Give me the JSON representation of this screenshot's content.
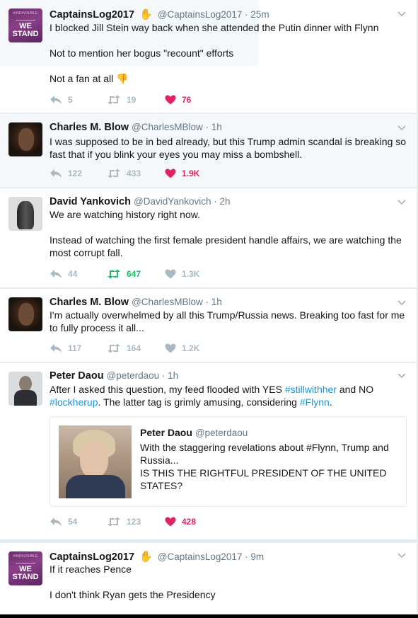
{
  "tweets": [
    {
      "author": "CaptainsLog2017",
      "handle": "@CaptainsLog2017",
      "time": "25m",
      "text": "I blocked Jill Stein way back when she attended the Putin dinner with Flynn\n\nNot to mention her bogus \"recount\" efforts\n\nNot a fan at all 👎",
      "avatar": "we-stand-avatar",
      "replies": "5",
      "retweets": "19",
      "likes": "76",
      "liked": true
    },
    {
      "author": "Charles M. Blow",
      "handle": "@CharlesMBlow",
      "time": "1h",
      "text": "I was supposed to be in bed already, but this Trump admin scandal is breaking so fast that if you blink your eyes you may miss a bombshell.",
      "replies": "122",
      "retweets": "433",
      "likes": "1.9K",
      "liked": true
    },
    {
      "author": "David Yankovich",
      "handle": "@DavidYankovich",
      "time": "2h",
      "text": "We are watching history right now.\n\nInstead of watching the first female president handle affairs, we are watching the most corrupt fall.",
      "replies": "44",
      "retweets": "647",
      "likes": "1.3K",
      "retweeted": true
    },
    {
      "author": "Charles M. Blow",
      "handle": "@CharlesMBlow",
      "time": "1h",
      "text": "I'm actually overwhelmed by all this Trump/Russia news. Breaking too fast for me to fully process it all...",
      "replies": "117",
      "retweets": "164",
      "likes": "1.2K"
    },
    {
      "author": "Peter Daou",
      "handle": "@peterdaou",
      "time": "1h",
      "text_parts": {
        "a": "After I asked this question, my feed flooded with YES ",
        "tag1": "#stillwithher",
        "b": " and NO ",
        "tag2": "#lockherup",
        "c": ". The latter tag is grimly amusing, considering ",
        "tag3": "#Flynn",
        "d": "."
      },
      "quote": {
        "author": "Peter Daou",
        "handle": "@peterdaou",
        "text": "With the staggering revelations about #Flynn, Trump and Russia...\nIS THIS THE RIGHTFUL PRESIDENT OF THE UNITED STATES?"
      },
      "replies": "54",
      "retweets": "123",
      "likes": "428",
      "liked": true
    },
    {
      "author": "CaptainsLog2017",
      "handle": "@CaptainsLog2017",
      "time": "9m",
      "text": "If it reaches Pence\n\nI don't think Ryan gets the Presidency"
    }
  ],
  "avatar_text": {
    "tiny": "#INDIVISIBLE",
    "we": "WE",
    "stand": "STAND"
  },
  "separator": " · ",
  "colors": {
    "like": "#e0245e",
    "retweet": "#17bf63",
    "link": "#1b95e0",
    "muted": "#aab8c2"
  }
}
